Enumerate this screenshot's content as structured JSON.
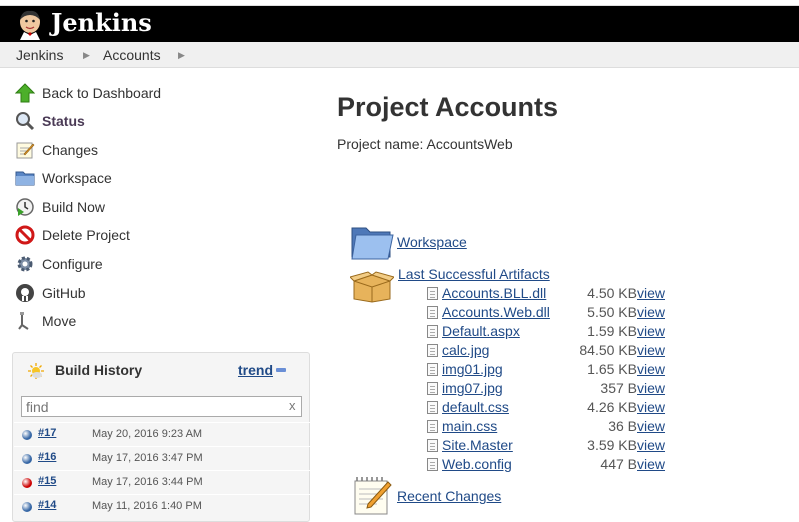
{
  "app": {
    "logo_text": "Jenkins",
    "accent": "#204a87"
  },
  "breadcrumbs": [
    {
      "label": "Jenkins"
    },
    {
      "label": "Accounts"
    }
  ],
  "tasks": [
    {
      "label": "Back to Dashboard",
      "icon": "up-arrow-icon"
    },
    {
      "label": "Status",
      "icon": "magnifier-icon"
    },
    {
      "label": "Changes",
      "icon": "notepad-icon"
    },
    {
      "label": "Workspace",
      "icon": "folder-icon"
    },
    {
      "label": "Build Now",
      "icon": "clock-play-icon"
    },
    {
      "label": "Delete Project",
      "icon": "no-entry-icon"
    },
    {
      "label": "Configure",
      "icon": "gear-icon"
    },
    {
      "label": "GitHub",
      "icon": "github-icon"
    },
    {
      "label": "Move",
      "icon": "move-icon"
    }
  ],
  "build_history": {
    "title": "Build History",
    "trend_label": "trend",
    "find_placeholder": "find",
    "clear_label": "x",
    "builds": [
      {
        "number": "#17",
        "date": "May 20, 2016 9:23 AM",
        "status": "success",
        "color": "#3465a4"
      },
      {
        "number": "#16",
        "date": "May 17, 2016 3:47 PM",
        "status": "success",
        "color": "#3465a4"
      },
      {
        "number": "#15",
        "date": "May 17, 2016 3:44 PM",
        "status": "failed",
        "color": "#cc0000"
      },
      {
        "number": "#14",
        "date": "May 11, 2016 1:40 PM",
        "status": "success",
        "color": "#3465a4"
      }
    ]
  },
  "main": {
    "title": "Project Accounts",
    "subtitle": "Project name: AccountsWeb",
    "workspace_label": "Workspace",
    "artifacts_label": "Last Successful Artifacts",
    "recent_changes_label": "Recent Changes",
    "artifacts": [
      {
        "name": "Accounts.BLL.dll",
        "size": "4.50 KB",
        "view": "view"
      },
      {
        "name": "Accounts.Web.dll",
        "size": "5.50 KB",
        "view": "view"
      },
      {
        "name": "Default.aspx",
        "size": "1.59 KB",
        "view": "view"
      },
      {
        "name": "calc.jpg",
        "size": "84.50 KB",
        "view": "view"
      },
      {
        "name": "img01.jpg",
        "size": "1.65 KB",
        "view": "view"
      },
      {
        "name": "img07.jpg",
        "size": "357 B",
        "view": "view"
      },
      {
        "name": "default.css",
        "size": "4.26 KB",
        "view": "view"
      },
      {
        "name": "main.css",
        "size": "36 B",
        "view": "view"
      },
      {
        "name": "Site.Master",
        "size": "3.59 KB",
        "view": "view"
      },
      {
        "name": "Web.config",
        "size": "447 B",
        "view": "view"
      }
    ]
  }
}
